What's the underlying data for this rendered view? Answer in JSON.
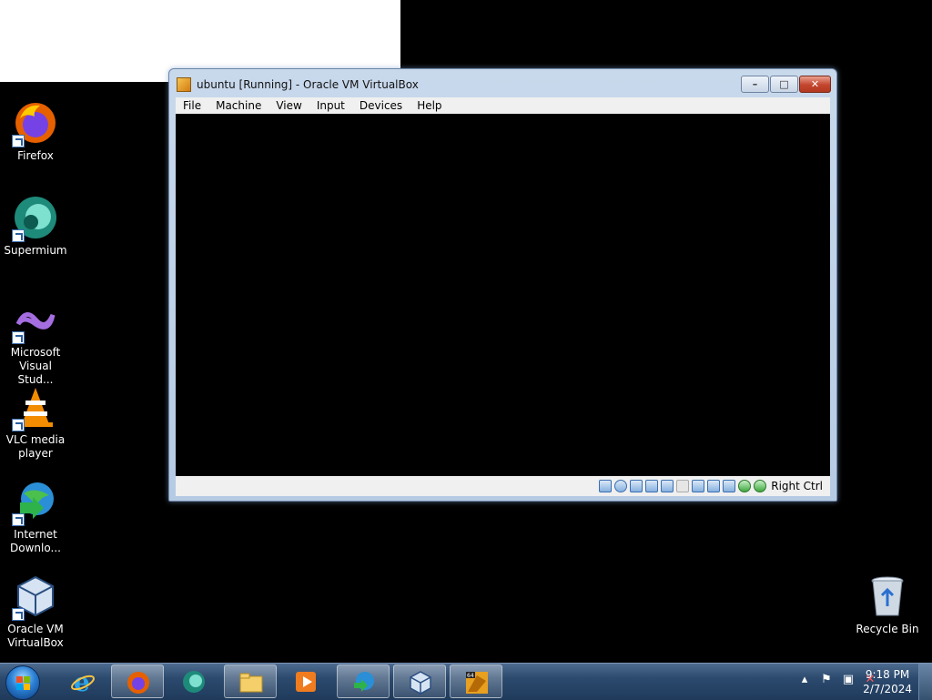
{
  "desktop": {
    "icons": [
      {
        "label_line1": "Firefox",
        "label_line2": ""
      },
      {
        "label_line1": "Supermium",
        "label_line2": ""
      },
      {
        "label_line1": "Microsoft",
        "label_line2": "Visual Stud..."
      },
      {
        "label_line1": "VLC media",
        "label_line2": "player"
      },
      {
        "label_line1": "Internet",
        "label_line2": "Downlo..."
      },
      {
        "label_line1": "Oracle VM",
        "label_line2": "VirtualBox"
      }
    ],
    "recycle_bin": "Recycle Bin"
  },
  "vbox": {
    "title": "ubuntu [Running] - Oracle VM VirtualBox",
    "menu": [
      "File",
      "Machine",
      "View",
      "Input",
      "Devices",
      "Help"
    ],
    "host_key": "Right Ctrl"
  },
  "taskbar": {
    "clock_time": "9:18 PM",
    "clock_date": "2/7/2024",
    "pinned": [
      "internet-explorer",
      "firefox",
      "supermium",
      "file-explorer",
      "media-player",
      "internet-download-manager",
      "virtualbox",
      "virtualbox-vm-running"
    ]
  },
  "colors": {
    "taskbar": "#2c4a6e",
    "desktop": "#000000",
    "window_frame": "#c9d9ec"
  }
}
